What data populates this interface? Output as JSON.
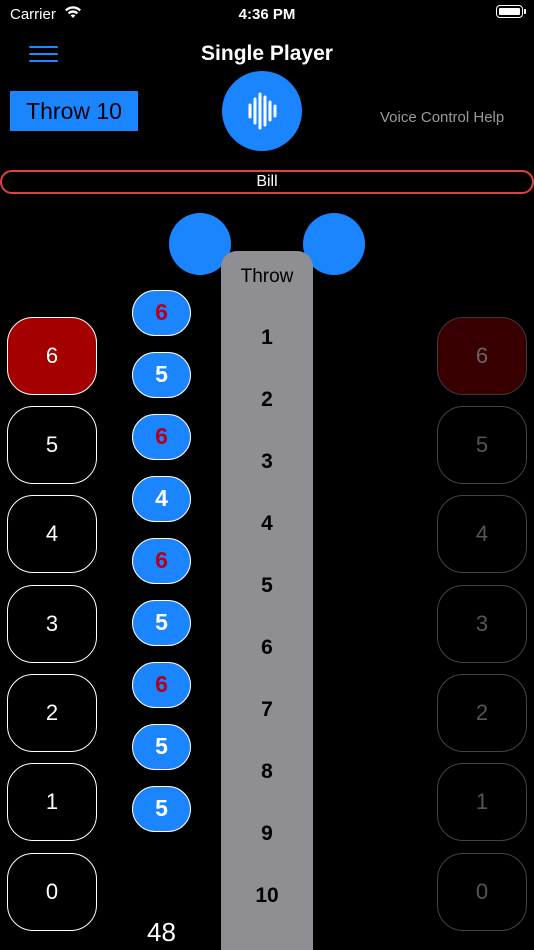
{
  "status": {
    "carrier": "Carrier",
    "time": "4:36 PM"
  },
  "nav": {
    "title": "Single Player"
  },
  "controls": {
    "throw_label": "Throw 10",
    "voice_help": "Voice Control Help"
  },
  "player": {
    "name": "Bill"
  },
  "throws": {
    "header": "Throw",
    "numbers": [
      "1",
      "2",
      "3",
      "4",
      "5",
      "6",
      "7",
      "8",
      "9",
      "10"
    ]
  },
  "left_scores": [
    "6",
    "5",
    "4",
    "3",
    "2",
    "1",
    "0"
  ],
  "right_scores": [
    "6",
    "5",
    "4",
    "3",
    "2",
    "1",
    "0"
  ],
  "selected_score": "6",
  "throw_results": [
    "6",
    "5",
    "6",
    "4",
    "6",
    "5",
    "6",
    "5",
    "5"
  ],
  "total": "48",
  "colors": {
    "accent": "#1a85ff",
    "selected": "#a50000",
    "player_border": "#e0433a",
    "six_text": "#b3001b"
  },
  "icons": {
    "menu": "hamburger-menu-icon",
    "voice": "waveform-icon",
    "wifi": "wifi-icon",
    "battery": "battery-icon"
  }
}
